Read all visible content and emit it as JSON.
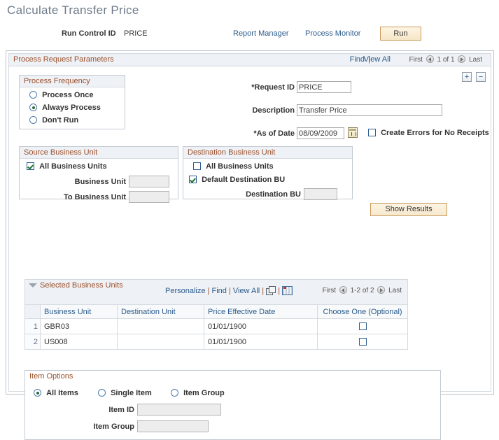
{
  "page": {
    "title": "Calculate Transfer Price"
  },
  "header": {
    "run_control_label": "Run Control ID",
    "run_control_value": "PRICE",
    "report_manager_link": "Report Manager",
    "process_monitor_link": "Process Monitor",
    "run_button": "Run"
  },
  "process_request": {
    "group_title": "Process Request Parameters",
    "find_link": "Find",
    "separator": "|",
    "view_all_link": "View All",
    "nav": {
      "first": "First",
      "counter": "1 of 1",
      "last": "Last"
    },
    "add_button": "+",
    "remove_button": "−",
    "frequency": {
      "title": "Process Frequency",
      "options": [
        {
          "label": "Process Once",
          "selected": false
        },
        {
          "label": "Always Process",
          "selected": true
        },
        {
          "label": "Don't Run",
          "selected": false
        }
      ]
    },
    "fields": {
      "request_id_label": "*Request ID",
      "request_id_value": "PRICE",
      "description_label": "Description",
      "description_value": "Transfer Price",
      "as_of_date_label": "*As of Date",
      "as_of_date_value": "08/09/2009",
      "create_errors_label": "Create Errors for No Receipts",
      "create_errors_checked": false
    },
    "source_bu": {
      "title": "Source Business Unit",
      "all_business_units_label": "All Business Units",
      "all_business_units_checked": true,
      "business_unit_label": "Business Unit",
      "business_unit_value": "",
      "to_business_unit_label": "To Business Unit",
      "to_business_unit_value": ""
    },
    "destination_bu": {
      "title": "Destination Business Unit",
      "all_business_units_label": "All Business Units",
      "all_business_units_checked": false,
      "default_destination_label": "Default Destination BU",
      "default_destination_checked": true,
      "destination_bu_label": "Destination BU",
      "destination_bu_value": ""
    },
    "show_results_button": "Show Results"
  },
  "selected_business_units": {
    "title": "Selected Business Units",
    "links": {
      "personalize": "Personalize",
      "find": "Find",
      "view_all": "View All"
    },
    "separator": "|",
    "nav": {
      "first": "First",
      "counter": "1-2 of 2",
      "last": "Last"
    },
    "columns": [
      "Business Unit",
      "Destination Unit",
      "Price Effective Date",
      "Choose One (Optional)"
    ],
    "rows": [
      {
        "num": "1",
        "business_unit": "GBR03",
        "destination_unit": "",
        "price_effective_date": "01/01/1900",
        "choose_one": false
      },
      {
        "num": "2",
        "business_unit": "US008",
        "destination_unit": "",
        "price_effective_date": "01/01/1900",
        "choose_one": false
      }
    ]
  },
  "item_options": {
    "title": "Item Options",
    "radios": [
      {
        "label": "All Items",
        "selected": true
      },
      {
        "label": "Single Item",
        "selected": false
      },
      {
        "label": "Item Group",
        "selected": false
      }
    ],
    "item_id_label": "Item ID",
    "item_id_value": "",
    "item_group_label": "Item Group",
    "item_group_value": ""
  }
}
